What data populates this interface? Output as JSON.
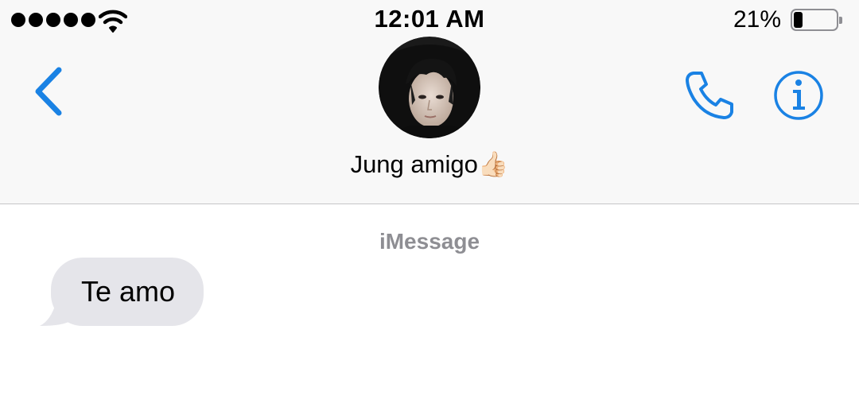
{
  "status_bar": {
    "signal_dots": 5,
    "time": "12:01 AM",
    "battery_percent": "21%",
    "battery_level": 0.21,
    "wifi_icon": "wifi-icon",
    "battery_icon": "battery-icon"
  },
  "nav": {
    "back_icon": "chevron-left-icon",
    "contact_name": "Jung amigo👍🏻",
    "call_icon": "phone-icon",
    "info_icon": "info-icon",
    "accent_color": "#1a82e4"
  },
  "conversation": {
    "service_label": "iMessage",
    "messages": [
      {
        "direction": "incoming",
        "text": "Te amo"
      }
    ]
  },
  "colors": {
    "header_bg": "#f8f8f8",
    "incoming_bubble": "#e5e5ea",
    "service_label": "#8e8e93"
  }
}
